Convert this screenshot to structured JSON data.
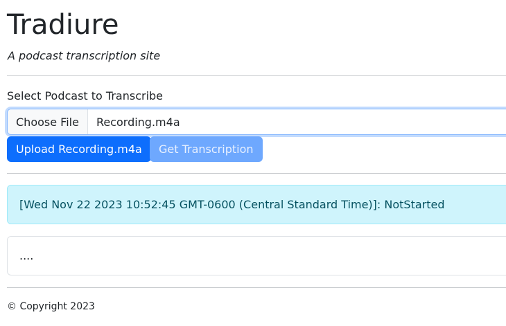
{
  "header": {
    "title": "Tradiure",
    "subtitle": "A podcast transcription site"
  },
  "form": {
    "label": "Select Podcast to Transcribe",
    "choose_file_label": "Choose File",
    "selected_file": "Recording.m4a",
    "upload_button": "Upload Recording.m4a",
    "transcribe_button": "Get Transcription"
  },
  "status": {
    "message": "[Wed Nov 22 2023 10:52:45 GMT-0600 (Central Standard Time)]: NotStarted"
  },
  "output": {
    "text": "...."
  },
  "footer": {
    "copyright": "© Copyright 2023"
  },
  "colors": {
    "primary": "#0d6efd",
    "primary_disabled": "#6ea8fe",
    "info_bg": "#cff4fc",
    "info_text": "#055160"
  }
}
